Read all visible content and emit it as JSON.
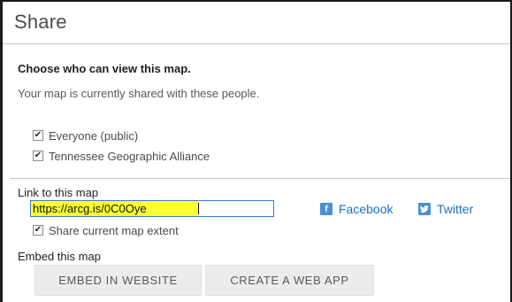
{
  "dialog": {
    "title": "Share"
  },
  "access": {
    "heading": "Choose who can view this map.",
    "description": "Your map is currently shared with these people.",
    "options": [
      {
        "label": "Everyone (public)",
        "checked": true
      },
      {
        "label": "Tennessee Geographic Alliance",
        "checked": true
      }
    ]
  },
  "link": {
    "heading": "Link to this map",
    "url": "https://arcg.is/0C0Oye",
    "share_extent_label": "Share current map extent",
    "share_extent_checked": true,
    "highlight_color": "#ffff33"
  },
  "social": {
    "facebook_label": "Facebook",
    "facebook_icon": "f",
    "twitter_label": "Twitter",
    "twitter_icon": "t",
    "accent": "#1f6fc5"
  },
  "embed": {
    "heading": "Embed this map",
    "embed_button": "EMBED IN WEBSITE",
    "web_app_button": "CREATE A WEB APP"
  }
}
